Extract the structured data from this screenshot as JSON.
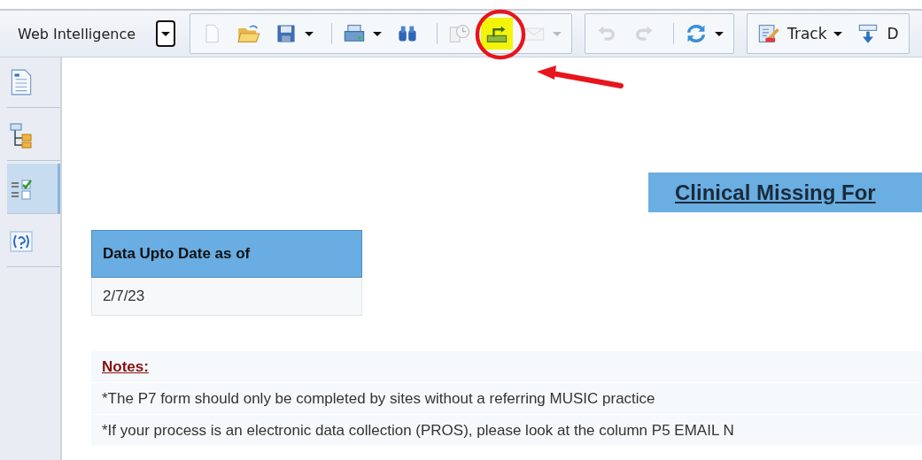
{
  "toolbar": {
    "app_menu": {
      "label": "Web Intelligence"
    },
    "groups": [
      [
        {
          "kind": "new",
          "disabled": true,
          "dropdown": false,
          "separator_before": false,
          "highlighted": false,
          "circled": false
        },
        {
          "kind": "open",
          "disabled": false,
          "dropdown": false,
          "separator_before": false,
          "highlighted": false,
          "circled": false
        },
        {
          "kind": "save",
          "disabled": false,
          "dropdown": true,
          "separator_before": false,
          "highlighted": false,
          "circled": false
        },
        {
          "kind": "print",
          "disabled": false,
          "dropdown": true,
          "separator_before": true,
          "highlighted": false,
          "circled": false
        },
        {
          "kind": "find",
          "disabled": false,
          "dropdown": false,
          "separator_before": false,
          "highlighted": false,
          "circled": false
        },
        {
          "kind": "schedule",
          "disabled": true,
          "dropdown": false,
          "separator_before": true,
          "highlighted": false,
          "circled": false
        },
        {
          "kind": "publish",
          "disabled": false,
          "dropdown": false,
          "separator_before": false,
          "highlighted": true,
          "circled": true
        },
        {
          "kind": "mail",
          "disabled": true,
          "dropdown": true,
          "separator_before": false,
          "highlighted": false,
          "circled": false
        }
      ],
      [
        {
          "kind": "undo",
          "disabled": true,
          "dropdown": false,
          "separator_before": false,
          "highlighted": false,
          "circled": false
        },
        {
          "kind": "redo",
          "disabled": true,
          "dropdown": false,
          "separator_before": false,
          "highlighted": false,
          "circled": false
        },
        {
          "kind": "refresh",
          "disabled": false,
          "dropdown": true,
          "separator_before": true,
          "highlighted": false,
          "circled": false
        }
      ],
      [
        {
          "kind": "track",
          "label": "Track",
          "disabled": false,
          "dropdown": true,
          "separator_before": false,
          "highlighted": false,
          "circled": false
        },
        {
          "kind": "download",
          "label": "D",
          "disabled": false,
          "dropdown": false,
          "separator_before": false,
          "highlighted": false,
          "circled": false
        }
      ]
    ]
  },
  "annotation_arrow": true,
  "sidebar": {
    "items": [
      {
        "kind": "document",
        "selected": false
      },
      {
        "kind": "structure",
        "selected": false
      },
      {
        "kind": "checklist",
        "selected": true
      },
      {
        "kind": "help",
        "selected": false
      }
    ]
  },
  "report": {
    "title": "Clinical Missing For",
    "table": {
      "header": "Data Upto Date as of",
      "value": "2/7/23"
    },
    "notes": {
      "heading": "Notes:",
      "lines": [
        "*The P7 form should only be completed by sites without a referring MUSIC practice",
        "*If your process is an electronic data collection (PROS), please look at the column P5 EMAIL N"
      ]
    }
  }
}
